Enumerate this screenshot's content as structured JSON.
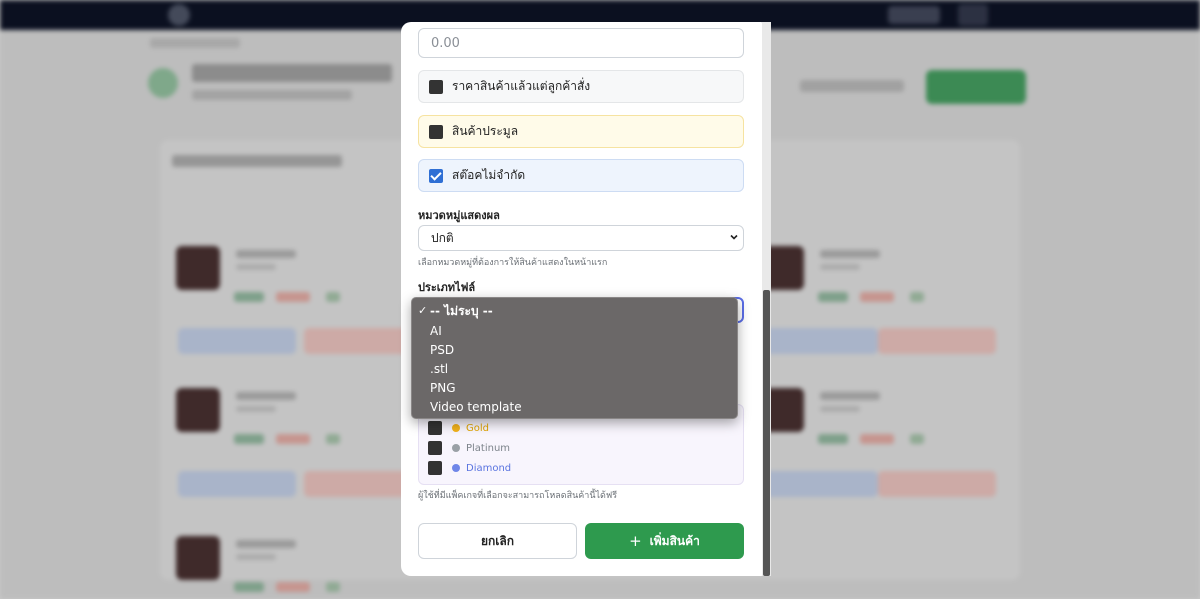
{
  "price_input": {
    "placeholder": "0.00"
  },
  "options": {
    "price_after_order": {
      "label": "ราคาสินค้าแล้วแต่ลูกค้าสั่ง",
      "checked": false
    },
    "auction": {
      "label": "สินค้าประมูล",
      "checked": false
    },
    "unlimited_stock": {
      "label": "สต๊อคไม่จำกัด",
      "checked": true
    }
  },
  "category": {
    "label": "หมวดหมู่แสดงผล",
    "selected": "ปกติ",
    "help": "เลือกหมวดหมู่ที่ต้องการให้สินค้าแสดงในหน้าแรก"
  },
  "file_type": {
    "label": "ประเภทไฟล์",
    "options": [
      "-- ไม่ระบุ --",
      "AI",
      "PSD",
      ".stl",
      "PNG",
      "Video template"
    ],
    "selected_index": 0
  },
  "packages": {
    "items": [
      {
        "name": "Gold",
        "color": "#f2b21b",
        "checked": false
      },
      {
        "name": "Platinum",
        "color": "#9aa0a6",
        "checked": false
      },
      {
        "name": "Diamond",
        "color": "#6f86e8",
        "checked": false
      }
    ],
    "help": "ผู้ใช้ที่มีแพ็คเกจที่เลือกจะสามารถโหลดสินค้านี้ได้ฟรี"
  },
  "actions": {
    "cancel": "ยกเลิก",
    "add": "เพิ่มสินค้า",
    "add_icon": "+"
  },
  "icons": {
    "checkmark": "✓",
    "chevron": "⌄"
  }
}
